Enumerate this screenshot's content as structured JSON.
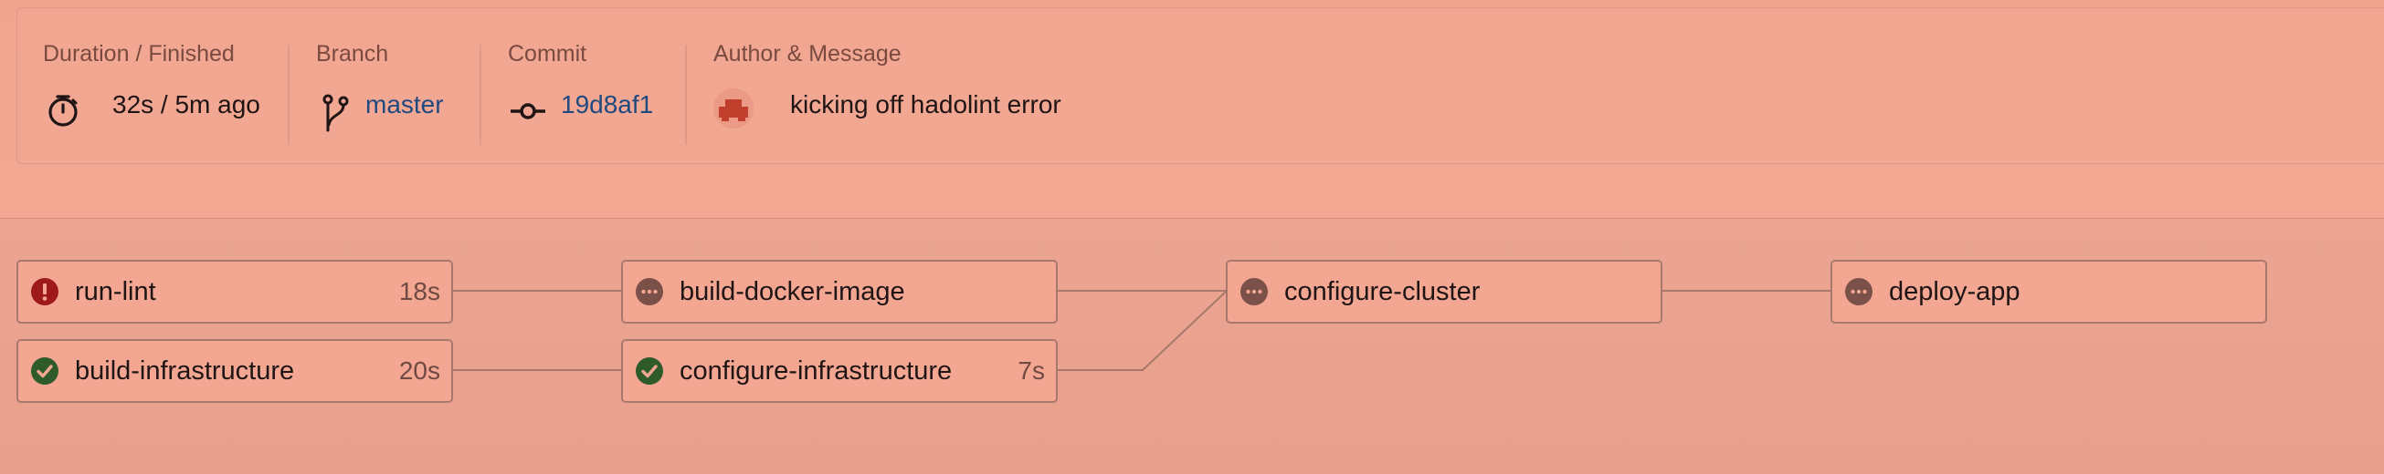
{
  "summary": {
    "duration": {
      "label": "Duration / Finished",
      "value": "32s / 5m ago",
      "icon": "stopwatch-icon"
    },
    "branch": {
      "label": "Branch",
      "value": "master",
      "icon": "git-branch-icon"
    },
    "commit": {
      "label": "Commit",
      "value": "19d8af1",
      "icon": "git-commit-icon"
    },
    "author": {
      "label": "Author & Message",
      "message": "kicking off hadolint error",
      "icon": "author-avatar"
    }
  },
  "pipeline": {
    "jobs": [
      {
        "name": "run-lint",
        "duration": "18s",
        "status": "failed"
      },
      {
        "name": "build-infrastructure",
        "duration": "20s",
        "status": "success"
      },
      {
        "name": "build-docker-image",
        "duration": "",
        "status": "pending"
      },
      {
        "name": "configure-infrastructure",
        "duration": "7s",
        "status": "success"
      },
      {
        "name": "configure-cluster",
        "duration": "",
        "status": "pending"
      },
      {
        "name": "deploy-app",
        "duration": "",
        "status": "pending"
      }
    ],
    "edges": [
      [
        "run-lint",
        "build-docker-image"
      ],
      [
        "build-infrastructure",
        "configure-infrastructure"
      ],
      [
        "build-docker-image",
        "configure-cluster"
      ],
      [
        "configure-infrastructure",
        "configure-cluster"
      ],
      [
        "configure-cluster",
        "deploy-app"
      ]
    ]
  },
  "colors": {
    "failed": "#9e1a1a",
    "success": "#2f5a2a",
    "pending": "#7a5048",
    "link": "#1f4a80"
  }
}
